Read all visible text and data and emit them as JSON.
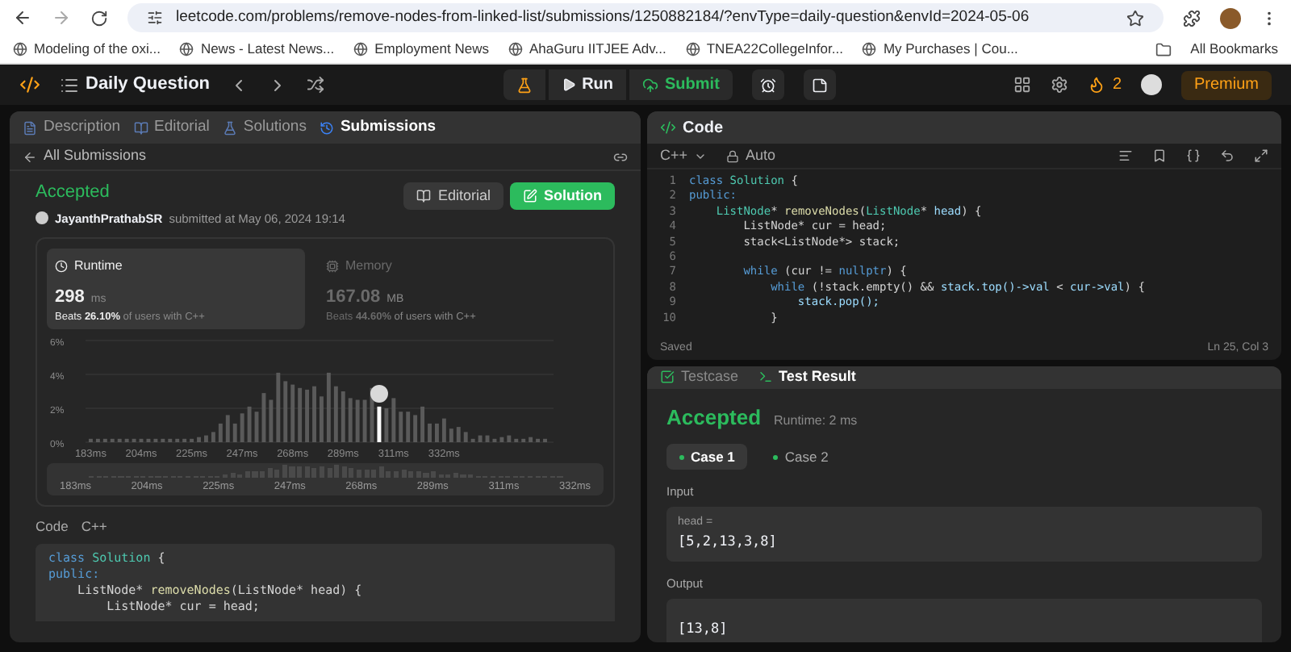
{
  "browser": {
    "url": "leetcode.com/problems/remove-nodes-from-linked-list/submissions/1250882184/?envType=daily-question&envId=2024-05-06",
    "bookmarks": [
      {
        "label": "Modeling of the oxi..."
      },
      {
        "label": "News - Latest News..."
      },
      {
        "label": "Employment News"
      },
      {
        "label": "AhaGuru IITJEE Adv..."
      },
      {
        "label": "TNEA22CollegeInfor..."
      },
      {
        "label": "My Purchases | Cou..."
      }
    ],
    "all_bookmarks": "All Bookmarks"
  },
  "topbar": {
    "title": "Daily Question",
    "run": "Run",
    "submit": "Submit",
    "streak": "2",
    "premium": "Premium"
  },
  "left_tabs": [
    {
      "label": "Description",
      "selected": false
    },
    {
      "label": "Editorial",
      "selected": false
    },
    {
      "label": "Solutions",
      "selected": false
    },
    {
      "label": "Submissions",
      "selected": true
    }
  ],
  "back_link": "All Submissions",
  "submission": {
    "status": "Accepted",
    "user": "JayanthPrathabSR",
    "submitted": "submitted at May 06, 2024 19:14",
    "editorial_button": "Editorial",
    "solution_button": "Solution",
    "stats": [
      {
        "title": "Runtime",
        "value": "298",
        "unit": "ms",
        "beats_prefix": "Beats",
        "beats": "26.10%",
        "beats_suffix": "of users with C++",
        "selected": true
      },
      {
        "title": "Memory",
        "value": "167.08",
        "unit": "MB",
        "beats_prefix": "Beats",
        "beats": "44.60%",
        "beats_suffix": "of users with C++",
        "selected": false
      }
    ],
    "chart_data": {
      "type": "bar",
      "stacked": true,
      "yticks": [
        {
          "value": 0,
          "label": "0%"
        },
        {
          "value": 2,
          "label": "2%"
        },
        {
          "value": 4,
          "label": "4%"
        },
        {
          "value": 6,
          "label": "6%"
        }
      ],
      "ylim": [
        0,
        6
      ],
      "categories": [
        "183ms",
        null,
        null,
        null,
        null,
        null,
        null,
        "204ms",
        null,
        null,
        null,
        null,
        null,
        null,
        "225ms",
        null,
        null,
        null,
        null,
        null,
        null,
        "247ms",
        null,
        null,
        null,
        null,
        null,
        null,
        "268ms",
        null,
        null,
        null,
        null,
        null,
        null,
        "289ms",
        null,
        null,
        null,
        null,
        null,
        null,
        "311ms",
        null,
        null,
        null,
        null,
        null,
        null,
        "332ms",
        null,
        null,
        null,
        null,
        null,
        null,
        null,
        null,
        null,
        null,
        null,
        null,
        null,
        null
      ],
      "series": [
        {
          "color": "#5a5a5a",
          "values": [
            0.2,
            0.2,
            0.2,
            0.2,
            0.2,
            0.2,
            0.2,
            0.2,
            0.2,
            0.2,
            0.2,
            0.2,
            0.2,
            0.2,
            0.2,
            0.3,
            0.4,
            0.6,
            1.1,
            1.6,
            1.1,
            1.7,
            2.1,
            1.8,
            2.9,
            2.5,
            4.1,
            3.6,
            3.4,
            3.2,
            3.1,
            3.3,
            2.7,
            4.1,
            3.3,
            3.0,
            2.6,
            2.5,
            2.5,
            3.2,
            null,
            2.0,
            2.6,
            1.8,
            1.8,
            1.6,
            2.1,
            1.1,
            1.1,
            1.4,
            0.8,
            0.9,
            0.6,
            0.2,
            0.4,
            0.4,
            0.2,
            0.3,
            0.4,
            0.2,
            0.2,
            0.3,
            0.2,
            0.2
          ]
        },
        {
          "color": "#ffffff",
          "values": [
            null,
            null,
            null,
            null,
            null,
            null,
            null,
            null,
            null,
            null,
            null,
            null,
            null,
            null,
            null,
            null,
            null,
            null,
            null,
            null,
            null,
            null,
            null,
            null,
            null,
            null,
            null,
            null,
            null,
            null,
            null,
            null,
            null,
            null,
            null,
            null,
            null,
            null,
            null,
            null,
            2.1,
            null,
            null,
            null,
            null,
            null,
            null,
            null,
            null,
            null,
            null,
            null,
            null,
            null,
            null,
            null,
            null,
            null,
            null,
            null,
            null,
            null,
            null,
            null
          ]
        }
      ]
    },
    "brush_labels": [
      "183ms",
      "204ms",
      "225ms",
      "247ms",
      "268ms",
      "289ms",
      "311ms",
      "332ms"
    ],
    "code_label": "Code",
    "code_lang": "C++",
    "code_lines": [
      [
        {
          "kind": "keyword",
          "text": "class "
        },
        {
          "kind": "type",
          "text": "Solution"
        },
        {
          "kind": "plain",
          "text": " {"
        }
      ],
      [
        {
          "kind": "keyword",
          "text": "public:"
        }
      ],
      [
        {
          "kind": "plain",
          "text": "    ListNode* "
        },
        {
          "kind": "function",
          "text": "removeNodes"
        },
        {
          "kind": "plain",
          "text": "(ListNode* head) {"
        }
      ],
      [
        {
          "kind": "plain",
          "text": "        ListNode* cur = head;"
        }
      ]
    ]
  },
  "editor": {
    "title": "Code",
    "language": "C++",
    "mode": "Auto",
    "status": "Saved",
    "cursor": "Ln 25, Col 3",
    "lines": [
      {
        "number": "1",
        "tokens": [
          {
            "kind": "keyword",
            "text": "class "
          },
          {
            "kind": "type",
            "text": "Solution"
          },
          {
            "kind": "plain",
            "text": " {"
          }
        ]
      },
      {
        "number": "2",
        "tokens": [
          {
            "kind": "keyword",
            "text": "public:"
          }
        ]
      },
      {
        "number": "3",
        "tokens": [
          {
            "kind": "type",
            "text": "    ListNode"
          },
          {
            "kind": "plain",
            "text": "* "
          },
          {
            "kind": "function",
            "text": "removeNodes"
          },
          {
            "kind": "plain",
            "text": "("
          },
          {
            "kind": "type",
            "text": "ListNode"
          },
          {
            "kind": "plain",
            "text": "* "
          },
          {
            "kind": "variable",
            "text": "head"
          },
          {
            "kind": "plain",
            "text": ") {"
          }
        ]
      },
      {
        "number": "4",
        "tokens": [
          {
            "kind": "plain",
            "text": "        ListNode* cur = head;"
          }
        ]
      },
      {
        "number": "5",
        "tokens": [
          {
            "kind": "plain",
            "text": "        stack<ListNode*> stack;"
          }
        ]
      },
      {
        "number": "6"
      },
      {
        "number": "7",
        "tokens": [
          {
            "kind": "keyword",
            "text": "        while"
          },
          {
            "kind": "plain",
            "text": " (cur != "
          },
          {
            "kind": "keyword",
            "text": "nullptr"
          },
          {
            "kind": "plain",
            "text": ") {"
          }
        ]
      },
      {
        "number": "8",
        "tokens": [
          {
            "kind": "keyword",
            "text": "            while"
          },
          {
            "kind": "plain",
            "text": " (!stack.empty() && "
          },
          {
            "kind": "variable",
            "text": "stack.top()->val"
          },
          {
            "kind": "plain",
            "text": " < "
          },
          {
            "kind": "variable",
            "text": "cur->val"
          },
          {
            "kind": "plain",
            "text": ") {"
          }
        ]
      },
      {
        "number": "9",
        "tokens": [
          {
            "kind": "variable",
            "text": "                stack.pop();"
          }
        ]
      },
      {
        "number": "10",
        "tokens": [
          {
            "kind": "plain",
            "text": "            }"
          }
        ]
      }
    ]
  },
  "bottom_tabs": [
    {
      "label": "Testcase",
      "selected": false
    },
    {
      "label": "Test Result",
      "selected": true
    }
  ],
  "result": {
    "status": "Accepted",
    "runtime": "Runtime: 2 ms",
    "cases": [
      {
        "label": "Case 1",
        "selected": true
      },
      {
        "label": "Case 2",
        "selected": false
      }
    ],
    "input_label": "Input",
    "input_name": "head =",
    "input_value": "[5,2,13,3,8]",
    "output_label": "Output",
    "output_value": "[13,8]"
  }
}
